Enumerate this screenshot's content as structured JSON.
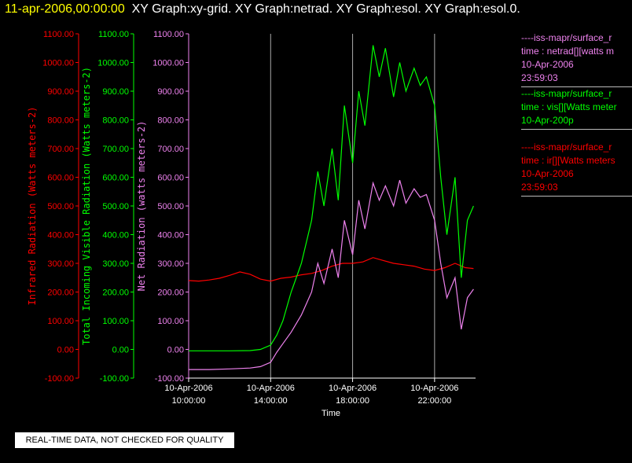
{
  "header": {
    "time": "11-apr-2006,00:00:00",
    "titles": "XY Graph:xy-grid.  XY Graph:netrad.  XY Graph:esol.  XY Graph:esol.0."
  },
  "axes": {
    "ir": {
      "label": "Infrared Radiation (Watts meters-2)",
      "color": "#ff0000",
      "ticks": [
        "1100.00",
        "1000.00",
        "900.00",
        "800.00",
        "700.00",
        "600.00",
        "500.00",
        "400.00",
        "300.00",
        "200.00",
        "100.00",
        "0.00",
        "-100.00"
      ]
    },
    "vis": {
      "label": "Total Incoming Visible Radiation (Watts meters-2)",
      "color": "#00ff00",
      "ticks": [
        "1100.00",
        "1000.00",
        "900.00",
        "800.00",
        "700.00",
        "600.00",
        "500.00",
        "400.00",
        "300.00",
        "200.00",
        "100.00",
        "0.00",
        "-100.00"
      ]
    },
    "net": {
      "label": "Net Radiation (watts meters-2)",
      "color": "#ee82ee",
      "ticks": [
        "1100.00",
        "1000.00",
        "900.00",
        "800.00",
        "700.00",
        "600.00",
        "500.00",
        "400.00",
        "300.00",
        "200.00",
        "100.00",
        "0.00",
        "-100.00"
      ]
    },
    "x": {
      "label": "Time",
      "ticks": [
        {
          "date": "10-Apr-2006",
          "time": "10:00:00"
        },
        {
          "date": "10-Apr-2006",
          "time": "14:00:00"
        },
        {
          "date": "10-Apr-2006",
          "time": "18:00:00"
        },
        {
          "date": "10-Apr-2006",
          "time": "22:00:00"
        }
      ]
    }
  },
  "legend": [
    {
      "color": "#ee82ee",
      "lines": [
        "----iss-mapr/surface_r",
        "time : netrad[][watts m",
        "10-Apr-2006",
        "23:59:03"
      ]
    },
    {
      "color": "#00ff00",
      "lines": [
        "----iss-mapr/surface_r",
        "time : vis[][Watts meter",
        "10-Apr-200p"
      ]
    },
    {
      "color": "#ff0000",
      "lines": [
        "----iss-mapr/surface_r",
        "time : ir[][Watts meters",
        "10-Apr-2006",
        "23:59:03"
      ]
    }
  ],
  "notice": "REAL-TIME DATA, NOT CHECKED FOR QUALITY",
  "chart_data": {
    "type": "line",
    "xlabel": "Time",
    "x_unit": "hours on 10-Apr-2006",
    "xlim": [
      10.0,
      24.0
    ],
    "ylim": [
      -100,
      1100
    ],
    "grid": "vertical lines at 14:00, 18:00, 22:00",
    "series": [
      {
        "name": "ir",
        "axis": "Infrared Radiation (Watts meters-2)",
        "color": "#ff0000",
        "x": [
          10.0,
          10.5,
          11.0,
          11.5,
          12.0,
          12.5,
          13.0,
          13.5,
          14.0,
          14.5,
          15.0,
          15.5,
          16.0,
          16.5,
          17.0,
          17.5,
          18.0,
          18.5,
          19.0,
          19.5,
          20.0,
          20.5,
          21.0,
          21.5,
          22.0,
          22.5,
          23.0,
          23.5,
          23.9
        ],
        "y": [
          240,
          238,
          242,
          248,
          258,
          270,
          262,
          245,
          238,
          248,
          252,
          260,
          265,
          275,
          290,
          300,
          300,
          305,
          320,
          310,
          300,
          295,
          290,
          280,
          275,
          285,
          300,
          285,
          282
        ]
      },
      {
        "name": "vis",
        "axis": "Total Incoming Visible Radiation (Watts meters-2)",
        "color": "#00ff00",
        "x": [
          10.0,
          11.0,
          12.0,
          13.0,
          13.5,
          14.0,
          14.3,
          14.6,
          15.0,
          15.5,
          16.0,
          16.3,
          16.6,
          17.0,
          17.3,
          17.6,
          18.0,
          18.3,
          18.6,
          19.0,
          19.3,
          19.6,
          20.0,
          20.3,
          20.6,
          21.0,
          21.3,
          21.6,
          22.0,
          22.3,
          22.6,
          23.0,
          23.3,
          23.6,
          23.9
        ],
        "y": [
          -5,
          -5,
          -5,
          -4,
          0,
          15,
          50,
          100,
          200,
          300,
          450,
          620,
          500,
          700,
          520,
          850,
          650,
          900,
          780,
          1060,
          950,
          1050,
          880,
          1000,
          900,
          980,
          920,
          950,
          850,
          600,
          400,
          600,
          250,
          450,
          500
        ]
      },
      {
        "name": "netrad",
        "axis": "Net Radiation (watts meters-2)",
        "color": "#ee82ee",
        "x": [
          10.0,
          11.0,
          12.0,
          13.0,
          13.5,
          14.0,
          14.3,
          14.6,
          15.0,
          15.5,
          16.0,
          16.3,
          16.6,
          17.0,
          17.3,
          17.6,
          18.0,
          18.3,
          18.6,
          19.0,
          19.3,
          19.6,
          20.0,
          20.3,
          20.6,
          21.0,
          21.3,
          21.6,
          22.0,
          22.3,
          22.6,
          23.0,
          23.3,
          23.6,
          23.9
        ],
        "y": [
          -70,
          -70,
          -68,
          -65,
          -60,
          -45,
          -10,
          20,
          60,
          120,
          200,
          300,
          230,
          350,
          250,
          450,
          330,
          520,
          420,
          580,
          520,
          570,
          500,
          590,
          510,
          560,
          530,
          540,
          450,
          300,
          180,
          250,
          70,
          180,
          210
        ]
      }
    ]
  }
}
